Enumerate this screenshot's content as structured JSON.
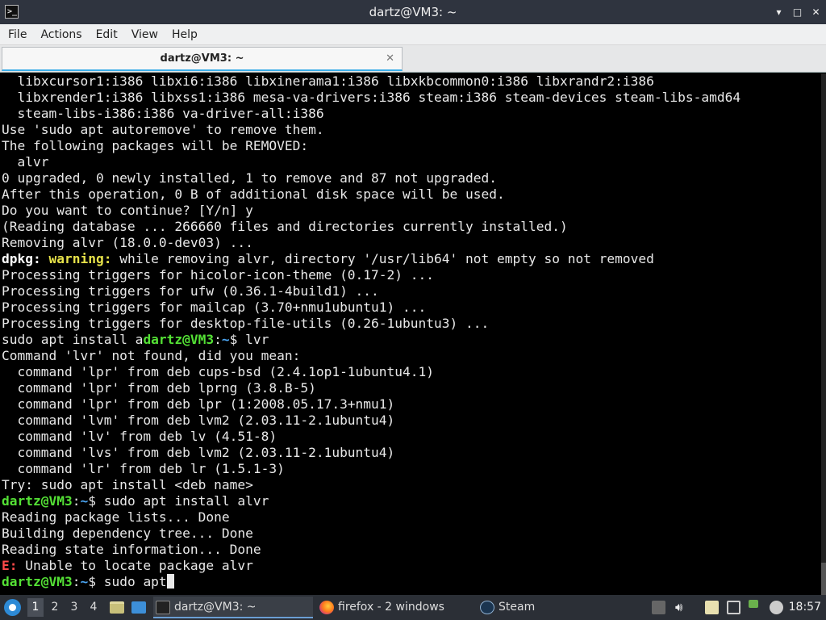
{
  "window": {
    "title": "dartz@VM3: ~",
    "app_icon_glyph": ">_",
    "controls": {
      "minimize": "▾",
      "maximize": "□",
      "close": "✕"
    }
  },
  "menubar": {
    "items": [
      "File",
      "Actions",
      "Edit",
      "View",
      "Help"
    ]
  },
  "tab": {
    "label": "dartz@VM3: ~",
    "close_glyph": "✕"
  },
  "terminal": {
    "lines": [
      [
        {
          "t": "  libxcursor1:i386 libxi6:i386 libxinerama1:i386 libxkbcommon0:i386 libxrandr2:i386"
        }
      ],
      [
        {
          "t": "  libxrender1:i386 libxss1:i386 mesa-va-drivers:i386 steam:i386 steam-devices steam-libs-amd64"
        }
      ],
      [
        {
          "t": "  steam-libs-i386:i386 va-driver-all:i386"
        }
      ],
      [
        {
          "t": "Use 'sudo apt autoremove' to remove them."
        }
      ],
      [
        {
          "t": "The following packages will be REMOVED:"
        }
      ],
      [
        {
          "t": "  alvr"
        }
      ],
      [
        {
          "t": "0 upgraded, 0 newly installed, 1 to remove and 87 not upgraded."
        }
      ],
      [
        {
          "t": "After this operation, 0 B of additional disk space will be used."
        }
      ],
      [
        {
          "t": "Do you want to continue? [Y/n] y"
        }
      ],
      [
        {
          "t": "(Reading database ... 266660 files and directories currently installed.)"
        }
      ],
      [
        {
          "t": "Removing alvr (18.0.0-dev03) ..."
        }
      ],
      [
        {
          "t": "dpkg: ",
          "c": "bold"
        },
        {
          "t": "warning:",
          "c": "yellow"
        },
        {
          "t": " while removing alvr, directory '/usr/lib64' not empty so not removed"
        }
      ],
      [
        {
          "t": "Processing triggers for hicolor-icon-theme (0.17-2) ..."
        }
      ],
      [
        {
          "t": "Processing triggers for ufw (0.36.1-4build1) ..."
        }
      ],
      [
        {
          "t": "Processing triggers for mailcap (3.70+nmu1ubuntu1) ..."
        }
      ],
      [
        {
          "t": "Processing triggers for desktop-file-utils (0.26-1ubuntu3) ..."
        }
      ],
      [
        {
          "t": "sudo apt install a"
        },
        {
          "t": "dartz@VM3",
          "c": "green"
        },
        {
          "t": ":"
        },
        {
          "t": "~",
          "c": "blue"
        },
        {
          "t": "$ lvr"
        }
      ],
      [
        {
          "t": "Command 'lvr' not found, did you mean:"
        }
      ],
      [
        {
          "t": "  command 'lpr' from deb cups-bsd (2.4.1op1-1ubuntu4.1)"
        }
      ],
      [
        {
          "t": "  command 'lpr' from deb lprng (3.8.B-5)"
        }
      ],
      [
        {
          "t": "  command 'lpr' from deb lpr (1:2008.05.17.3+nmu1)"
        }
      ],
      [
        {
          "t": "  command 'lvm' from deb lvm2 (2.03.11-2.1ubuntu4)"
        }
      ],
      [
        {
          "t": "  command 'lv' from deb lv (4.51-8)"
        }
      ],
      [
        {
          "t": "  command 'lvs' from deb lvm2 (2.03.11-2.1ubuntu4)"
        }
      ],
      [
        {
          "t": "  command 'lr' from deb lr (1.5.1-3)"
        }
      ],
      [
        {
          "t": "Try: sudo apt install <deb name>"
        }
      ],
      [
        {
          "t": "dartz@VM3",
          "c": "green"
        },
        {
          "t": ":"
        },
        {
          "t": "~",
          "c": "blue"
        },
        {
          "t": "$ sudo apt install alvr"
        }
      ],
      [
        {
          "t": "Reading package lists... Done"
        }
      ],
      [
        {
          "t": "Building dependency tree... Done"
        }
      ],
      [
        {
          "t": "Reading state information... Done"
        }
      ],
      [
        {
          "t": "E:",
          "c": "red"
        },
        {
          "t": " Unable to locate package alvr"
        }
      ],
      [
        {
          "t": "dartz@VM3",
          "c": "green"
        },
        {
          "t": ":"
        },
        {
          "t": "~",
          "c": "blue"
        },
        {
          "t": "$ sudo apt"
        }
      ]
    ],
    "cursor_visible": true
  },
  "taskbar": {
    "workspaces": [
      "1",
      "2",
      "3",
      "4"
    ],
    "active_workspace": "1",
    "tasks": {
      "terminal": "dartz@VM3: ~",
      "firefox": "firefox - 2 windows",
      "steam": "Steam"
    },
    "clock": "18:57"
  },
  "colors": {
    "prompt_user": "#54e135",
    "prompt_path": "#4aa3f0",
    "warning": "#e8e34a",
    "error": "#ff4a4a",
    "titlebar_bg": "#2f343f",
    "taskbar_bg": "#2b2f36"
  },
  "icons": {
    "start": "lxqt-start-icon",
    "file_manager": "folder-icon",
    "desktop": "show-desktop-icon",
    "terminal": "terminal-icon",
    "firefox": "firefox-icon",
    "steam": "steam-icon",
    "tray": [
      "clipboard-icon",
      "volume-icon",
      "notes-icon",
      "network-icon",
      "steam-tray-icon"
    ]
  }
}
